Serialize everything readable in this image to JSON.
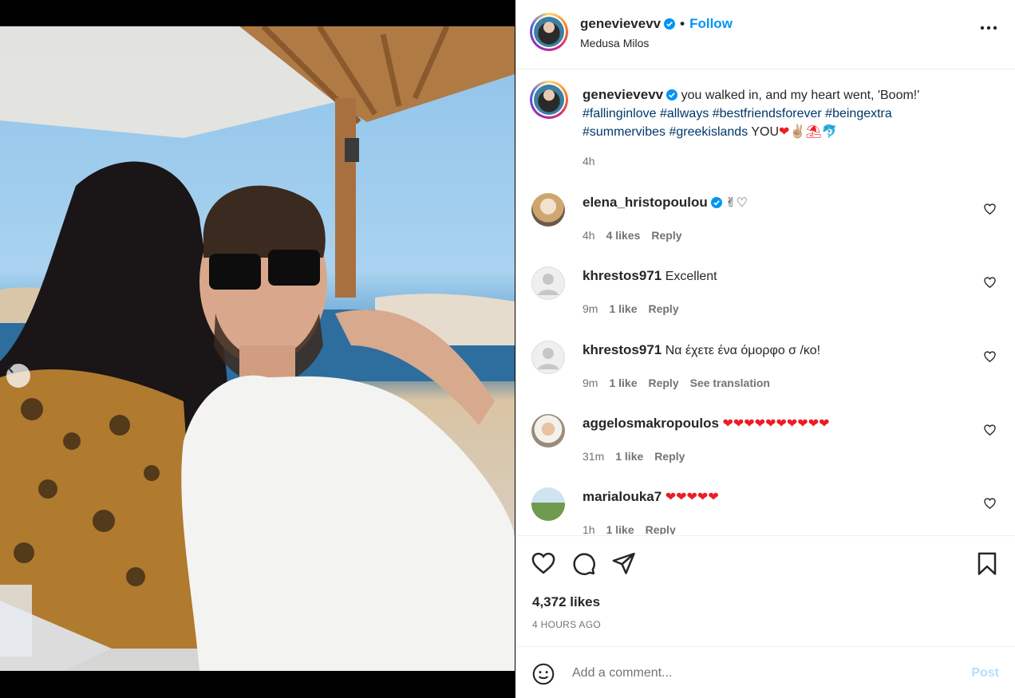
{
  "post": {
    "username": "genevievevv",
    "follow_label": "Follow",
    "separator": "•",
    "location": "Medusa Milos",
    "caption_text": "you walked in, and my heart went, 'Boom!'",
    "hashtags_line1": "#fallinginlove #allways #bestfriendsforever #beingextra",
    "hashtags_line2": "#summervibes #greekislands",
    "caption_tail": "YOU",
    "caption_emojis": "❤✌🏼⛱🐬",
    "caption_time": "4h"
  },
  "comments": [
    {
      "username": "elena_hristopoulou",
      "verified": true,
      "text": "✌♡",
      "time": "4h",
      "likes": "4 likes",
      "reply": "Reply"
    },
    {
      "username": "khrestos971",
      "verified": false,
      "text": "Excellent",
      "time": "9m",
      "likes": "1 like",
      "reply": "Reply"
    },
    {
      "username": "khrestos971",
      "verified": false,
      "text": "Να έχετε ένα όμορφο σ /κο!",
      "time": "9m",
      "likes": "1 like",
      "reply": "Reply",
      "translate": "See translation"
    },
    {
      "username": "aggelosmakropoulos",
      "verified": false,
      "text": "❤❤❤❤❤❤❤❤❤❤",
      "time": "31m",
      "likes": "1 like",
      "reply": "Reply"
    },
    {
      "username": "marialouka7",
      "verified": false,
      "text": "❤❤❤❤❤",
      "time": "1h",
      "likes": "1 like",
      "reply": "Reply"
    }
  ],
  "footer": {
    "likes": "4,372 likes",
    "time_ago": "4 HOURS AGO",
    "comment_placeholder": "Add a comment...",
    "post_label": "Post"
  },
  "carousel": {
    "count": 2,
    "active": 1
  },
  "colors": {
    "link_blue": "#0095f6",
    "hashtag": "#00376b",
    "muted": "#737373",
    "post_disabled": "#b2dffc",
    "heart": "#ed1c24"
  },
  "icons": [
    "verified-badge-icon",
    "more-options-icon",
    "heart-icon",
    "comment-icon",
    "share-icon",
    "bookmark-icon",
    "emoji-icon",
    "chevron-left-icon"
  ]
}
